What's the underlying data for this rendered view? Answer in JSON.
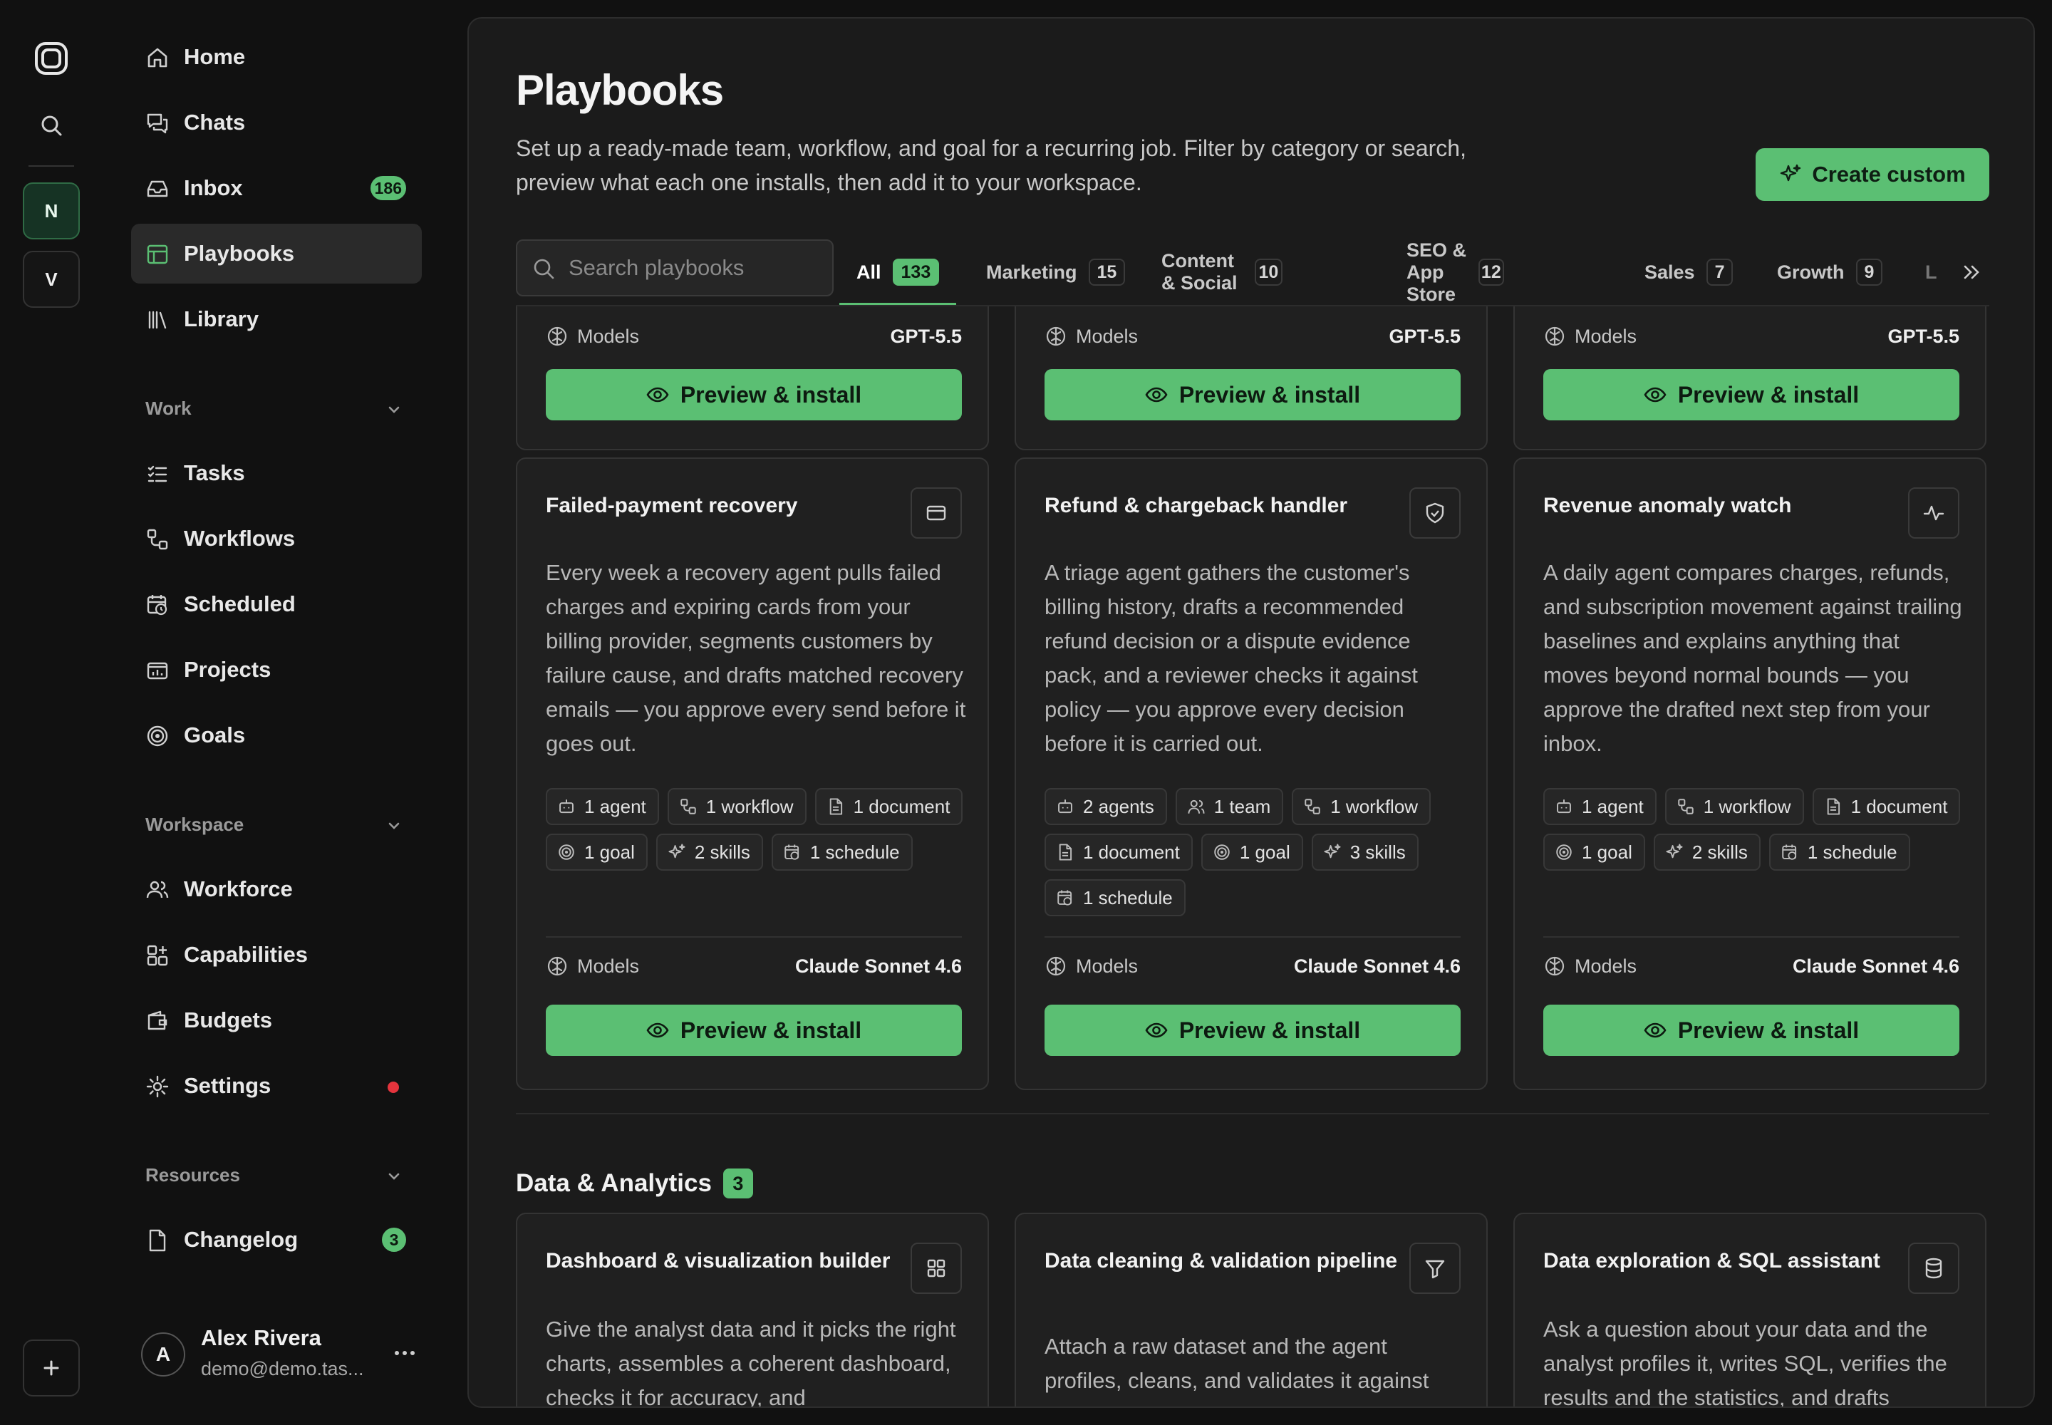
{
  "rail": {
    "workspaces": [
      "N",
      "V"
    ]
  },
  "sidebar": {
    "nav_top": [
      {
        "label": "Home",
        "icon": "home-icon"
      },
      {
        "label": "Chats",
        "icon": "chat-icon"
      },
      {
        "label": "Inbox",
        "icon": "inbox-icon",
        "badge": "186"
      },
      {
        "label": "Playbooks",
        "icon": "playbook-icon",
        "active": true
      },
      {
        "label": "Library",
        "icon": "library-icon"
      }
    ],
    "work_label": "Work",
    "work_items": [
      "Tasks",
      "Workflows",
      "Scheduled",
      "Projects",
      "Goals"
    ],
    "workspace_label": "Workspace",
    "workspace_items": [
      "Workforce",
      "Capabilities",
      "Budgets",
      "Settings"
    ],
    "resources_label": "Resources",
    "resources_items": [
      {
        "label": "Changelog",
        "badge": "3"
      }
    ],
    "user": {
      "initial": "A",
      "name": "Alex Rivera",
      "email": "demo@demo.tas..."
    }
  },
  "main": {
    "title": "Playbooks",
    "description": "Set up a ready-made team, workflow, and goal for a recurring job. Filter by category or search, preview what each one installs, then add it to your workspace.",
    "create_button": "Create custom",
    "search_placeholder": "Search playbooks",
    "tabs": [
      {
        "label": "All",
        "count": "133"
      },
      {
        "label": "Marketing",
        "count": "15"
      },
      {
        "label": "Content & Social",
        "count": "10"
      },
      {
        "label": "SEO & App Store",
        "count": "12"
      },
      {
        "label": "Sales",
        "count": "7"
      },
      {
        "label": "Growth",
        "count": "9"
      }
    ],
    "tab_overflow": "L",
    "top_cards": [
      {
        "models_label": "Models",
        "model": "GPT-5.5",
        "button": "Preview & install"
      },
      {
        "models_label": "Models",
        "model": "GPT-5.5",
        "button": "Preview & install"
      },
      {
        "models_label": "Models",
        "model": "GPT-5.5",
        "button": "Preview & install"
      }
    ],
    "cards": [
      {
        "title": "Failed-payment recovery",
        "icon": "credit-card-icon",
        "description": "Every week a recovery agent pulls failed charges and expiring cards from your billing provider, segments customers by failure cause, and drafts matched recovery emails — you approve every send before it goes out.",
        "chips": [
          [
            "1 agent",
            "bot-icon"
          ],
          [
            "1 workflow",
            "workflow-icon"
          ],
          [
            "1 document",
            "document-icon"
          ],
          [
            "1 goal",
            "target-icon"
          ],
          [
            "2 skills",
            "sparkle-icon"
          ],
          [
            "1 schedule",
            "calendar-clock-icon"
          ]
        ],
        "models_label": "Models",
        "model": "Claude Sonnet 4.6",
        "button": "Preview & install"
      },
      {
        "title": "Refund & chargeback handler",
        "icon": "shield-icon",
        "description": "A triage agent gathers the customer's billing history, drafts a recommended refund decision or a dispute evidence pack, and a reviewer checks it against policy — you approve every decision before it is carried out.",
        "chips": [
          [
            "2 agents",
            "bot-icon"
          ],
          [
            "1 team",
            "team-icon"
          ],
          [
            "1 workflow",
            "workflow-icon"
          ],
          [
            "1 document",
            "document-icon"
          ],
          [
            "1 goal",
            "target-icon"
          ],
          [
            "3 skills",
            "sparkle-icon"
          ],
          [
            "1 schedule",
            "calendar-clock-icon"
          ]
        ],
        "models_label": "Models",
        "model": "Claude Sonnet 4.6",
        "button": "Preview & install"
      },
      {
        "title": "Revenue anomaly watch",
        "icon": "pulse-icon",
        "description": "A daily agent compares charges, refunds, and subscription movement against trailing baselines and explains anything that moves beyond normal bounds — you approve the drafted next step from your inbox.",
        "chips": [
          [
            "1 agent",
            "bot-icon"
          ],
          [
            "1 workflow",
            "workflow-icon"
          ],
          [
            "1 document",
            "document-icon"
          ],
          [
            "1 goal",
            "target-icon"
          ],
          [
            "2 skills",
            "sparkle-icon"
          ],
          [
            "1 schedule",
            "calendar-clock-icon"
          ]
        ],
        "models_label": "Models",
        "model": "Claude Sonnet 4.6",
        "button": "Preview & install"
      }
    ],
    "section": {
      "label": "Data & Analytics",
      "count": "3"
    },
    "section_cards": [
      {
        "title": "Dashboard & visualization builder",
        "icon": "grid-icon",
        "description": "Give the analyst data and it picks the right charts, assembles a coherent dashboard, checks it for accuracy, and"
      },
      {
        "title": "Data cleaning & validation pipeline",
        "icon": "filter-icon",
        "description": "Attach a raw dataset and the agent profiles, cleans, and validates it against explicit rules, then drafts the cleaned"
      },
      {
        "title": "Data exploration & SQL assistant",
        "icon": "database-icon",
        "description": "Ask a question about your data and the analyst profiles it, writes SQL, verifies the results and the statistics, and drafts"
      }
    ],
    "colors": {
      "accent": "#5bbf73",
      "danger": "#e5343d",
      "panel": "#1b1b1b",
      "card": "#202020"
    }
  }
}
